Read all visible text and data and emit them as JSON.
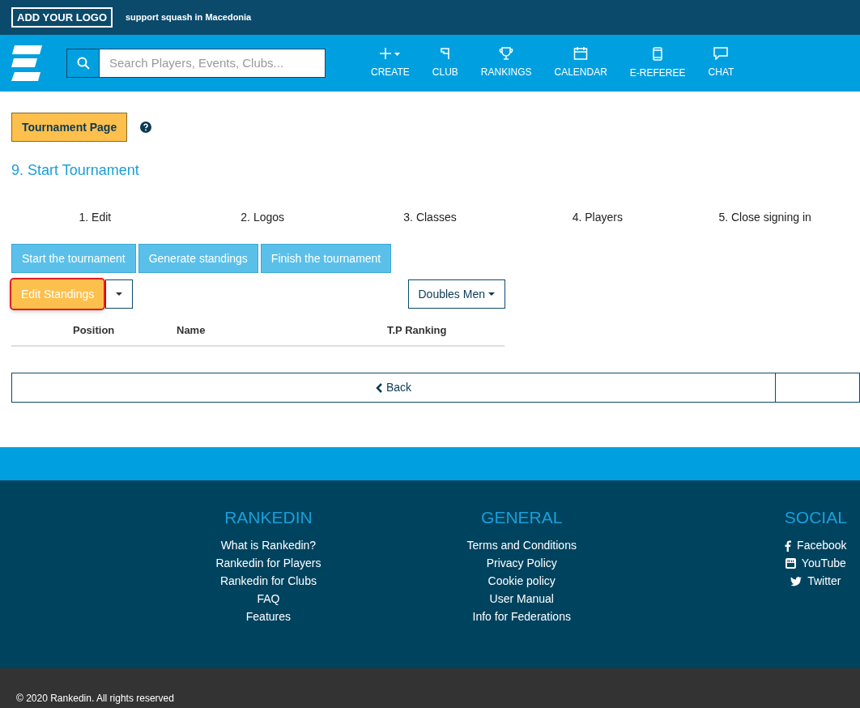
{
  "topbar": {
    "logo": "ADD YOUR LOGO",
    "tagline": "support squash in Macedonia"
  },
  "nav": {
    "search": {
      "placeholder": "Search Players, Events, Clubs..."
    },
    "items": [
      {
        "kind": "create",
        "label": "CREATE"
      },
      {
        "kind": "club",
        "label": "CLUB"
      },
      {
        "kind": "rankings",
        "label": "RANKINGS"
      },
      {
        "kind": "calendar",
        "label": "CALENDAR"
      },
      {
        "kind": "referee",
        "label": "E-REFEREE"
      },
      {
        "kind": "chat",
        "label": "CHAT"
      }
    ]
  },
  "tournament_page_button": "Tournament Page",
  "step_title": "9. Start Tournament",
  "steps": [
    "1. Edit",
    "2. Logos",
    "3. Classes",
    "4. Players",
    "5. Close signing in"
  ],
  "actions": [
    "Start the tournament",
    "Generate standings",
    "Finish the tournament"
  ],
  "edit_standings": {
    "label": "Edit Standings",
    "focused": true
  },
  "class_dropdown": "Doubles Men",
  "table": {
    "columns": [
      "Position",
      "Name",
      "T.P Ranking"
    ]
  },
  "back_button": "Back",
  "footer": {
    "columns": [
      {
        "title": "RANKEDIN",
        "links": [
          {
            "label": "What is Rankedin?"
          },
          {
            "label": "Rankedin for Players"
          },
          {
            "label": "Rankedin for Clubs"
          },
          {
            "label": "FAQ"
          },
          {
            "label": "Features"
          }
        ]
      },
      {
        "title": "GENERAL",
        "links": [
          {
            "label": "Terms and Conditions"
          },
          {
            "label": "Privacy Policy"
          },
          {
            "label": "Cookie policy"
          },
          {
            "label": "User Manual"
          },
          {
            "label": "Info for Federations"
          }
        ]
      },
      {
        "title": "SOCIAL",
        "links": [
          {
            "kind": "facebook",
            "label": "Facebook"
          },
          {
            "kind": "youtube",
            "label": "YouTube"
          },
          {
            "kind": "twitter",
            "label": "Twitter"
          }
        ]
      }
    ]
  },
  "copyright": "© 2020 Rankedin. All rights reserved"
}
